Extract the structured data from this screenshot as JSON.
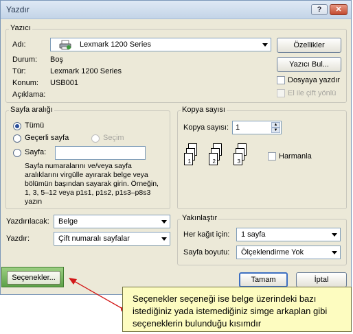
{
  "window": {
    "title": "Yazdır",
    "help_icon": "?",
    "close_icon": "✕"
  },
  "printer": {
    "legend": "Yazıcı",
    "name_label": "Adı:",
    "name_value": "Lexmark 1200 Series",
    "status_label": "Durum:",
    "status_value": "Boş",
    "type_label": "Tür:",
    "type_value": "Lexmark 1200 Series",
    "location_label": "Konum:",
    "location_value": "USB001",
    "comment_label": "Açıklama:",
    "properties_button": "Özellikler",
    "find_printer_button": "Yazıcı Bul...",
    "print_to_file_label": "Dosyaya yazdır",
    "manual_duplex_label": "El ile çift yönlü"
  },
  "page_range": {
    "legend": "Sayfa aralığı",
    "all_label": "Tümü",
    "current_label": "Geçerli sayfa",
    "selection_label": "Seçim",
    "pages_label": "Sayfa:",
    "help_text": "Sayfa numaralarını ve/veya sayfa aralıklarını virgülle ayırarak belge veya bölümün başından sayarak girin. Örneğin, 1, 3, 5–12 veya p1s1, p1s2, p1s3–p8s3 yazın"
  },
  "copies": {
    "legend": "Kopya sayısı",
    "count_label": "Kopya sayısı:",
    "count_value": "1",
    "collate_label": "Harmanla",
    "page_numbers": [
      "1",
      "2",
      "3"
    ]
  },
  "print_what": {
    "label": "Yazdırılacak:",
    "value": "Belge"
  },
  "print": {
    "label": "Yazdır:",
    "value": "Çift numaralı sayfalar"
  },
  "zoom": {
    "legend": "Yakınlaştır",
    "pages_per_sheet_label": "Her kağıt için:",
    "pages_per_sheet_value": "1 sayfa",
    "scale_label": "Sayfa boyutu:",
    "scale_value": "Ölçeklendirme Yok"
  },
  "buttons": {
    "options": "Seçenekler...",
    "ok": "Tamam",
    "cancel": "İptal"
  },
  "callout": {
    "text": "Seçenekler seçeneği ise belge üzerindeki bazı istediğiniz yada istemediğiniz simge arkaplan gibi seçeneklerin bulunduğu kısımdır"
  }
}
